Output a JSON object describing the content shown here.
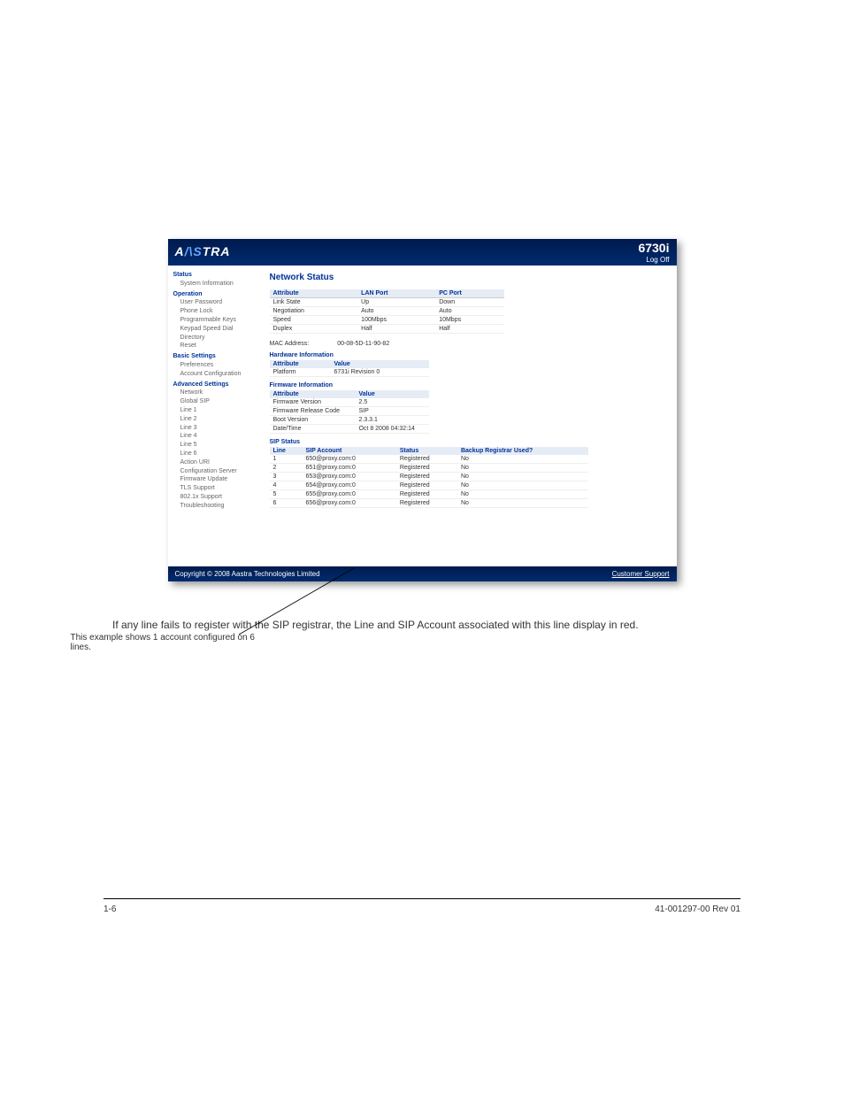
{
  "header": {
    "logo_a": "A",
    "logo_mid": "/\\S",
    "logo_rest": "TRA",
    "model": "6730i",
    "logoff": "Log Off"
  },
  "sidebar": {
    "groups": [
      {
        "title": "Status",
        "items": [
          "System Information"
        ]
      },
      {
        "title": "Operation",
        "items": [
          "User Password",
          "Phone Lock",
          "Programmable Keys",
          "Keypad Speed Dial",
          "Directory",
          "Reset"
        ]
      },
      {
        "title": "Basic Settings",
        "items": [
          "Preferences",
          "Account Configuration"
        ]
      },
      {
        "title": "Advanced Settings",
        "items": [
          "Network",
          "Global SIP",
          "Line 1",
          "Line 2",
          "Line 3",
          "Line 4",
          "Line 5",
          "Line 6",
          "Action URI",
          "Configuration Server",
          "Firmware Update",
          "TLS Support",
          "802.1x Support",
          "Troubleshooting"
        ]
      }
    ]
  },
  "content": {
    "title": "Network Status",
    "net_headers": [
      "Attribute",
      "LAN Port",
      "PC Port"
    ],
    "net_rows": [
      [
        "Link State",
        "Up",
        "Down"
      ],
      [
        "Negotiation",
        "Auto",
        "Auto"
      ],
      [
        "Speed",
        "100Mbps",
        "10Mbps"
      ],
      [
        "Duplex",
        "Half",
        "Half"
      ]
    ],
    "mac_label": "MAC Address:",
    "mac_value": "00-08-5D-11-90-82",
    "hw_title": "Hardware Information",
    "hw_headers": [
      "Attribute",
      "Value"
    ],
    "hw_rows": [
      [
        "Platform",
        "6731i Revision 0"
      ]
    ],
    "fw_title": "Firmware Information",
    "fw_headers": [
      "Attribute",
      "Value"
    ],
    "fw_rows": [
      [
        "Firmware Version",
        "2.5"
      ],
      [
        "Firmware Release Code",
        "SIP"
      ],
      [
        "Boot Version",
        "2.3.3.1"
      ],
      [
        "Date/Time",
        "Oct 8 2008 04:32:14"
      ]
    ],
    "sip_title": "SIP Status",
    "sip_headers": [
      "Line",
      "SIP Account",
      "Status",
      "Backup Registrar Used?"
    ],
    "sip_rows": [
      [
        "1",
        "650@proxy.com:0",
        "Registered",
        "No"
      ],
      [
        "2",
        "651@proxy.com:0",
        "Registered",
        "No"
      ],
      [
        "3",
        "653@proxy.com:0",
        "Registered",
        "No"
      ],
      [
        "4",
        "654@proxy.com:0",
        "Registered",
        "No"
      ],
      [
        "5",
        "655@proxy.com:0",
        "Registered",
        "No"
      ],
      [
        "6",
        "656@proxy.com:0",
        "Registered",
        "No"
      ]
    ]
  },
  "footer": {
    "copyright": "Copyright © 2008 Aastra Technologies Limited",
    "support": "Customer Support"
  },
  "doc": {
    "callout": "This example shows 1 account configured on 6 lines.",
    "para": "If any line fails to register with the SIP registrar, the Line and SIP Account associated with this line display in red.",
    "footer_left": "1-6",
    "footer_right": "41-001297-00 Rev 01"
  }
}
